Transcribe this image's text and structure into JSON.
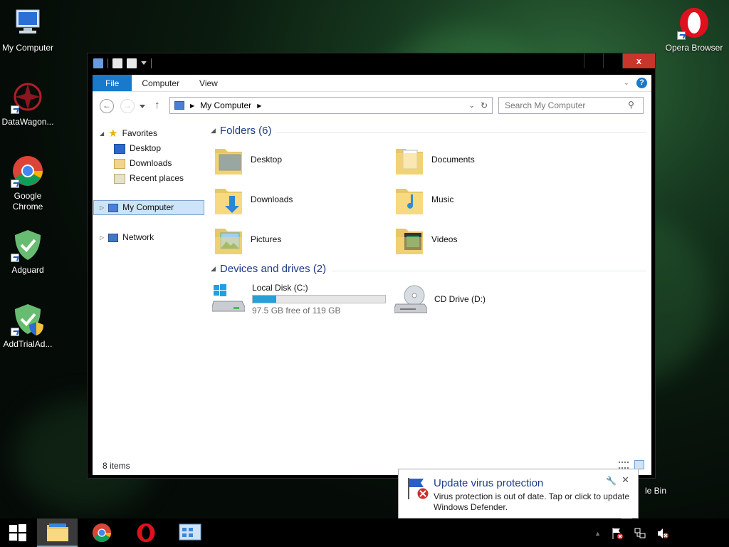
{
  "desktop": {
    "icons": [
      {
        "label": "My Computer"
      },
      {
        "label": "DataWagon..."
      },
      {
        "label": "Google Chrome"
      },
      {
        "label": "Adguard"
      },
      {
        "label": "AddTrialAd..."
      },
      {
        "label": "Opera Browser"
      },
      {
        "label": "le Bin"
      }
    ]
  },
  "window": {
    "close_glyph": "x",
    "ribbon": {
      "tabs": [
        "File",
        "Computer",
        "View"
      ]
    },
    "address": {
      "location": "My Computer"
    },
    "search": {
      "placeholder": "Search My Computer"
    },
    "nav_pane": {
      "favorites": "Favorites",
      "items": [
        "Desktop",
        "Downloads",
        "Recent places"
      ],
      "my_computer": "My Computer",
      "network": "Network"
    },
    "folders_header": "Folders (6)",
    "folders": [
      "Desktop",
      "Documents",
      "Downloads",
      "Music",
      "Pictures",
      "Videos"
    ],
    "devices_header": "Devices and drives (2)",
    "drives": [
      {
        "name": "Local Disk (C:)",
        "free_text": "97.5 GB free of 119 GB",
        "used_fraction": 0.18
      },
      {
        "name": "CD Drive (D:)"
      }
    ],
    "status": "8 items"
  },
  "notification": {
    "title": "Update virus protection",
    "body": "Virus protection is out of date. Tap or click to update Windows Defender."
  }
}
